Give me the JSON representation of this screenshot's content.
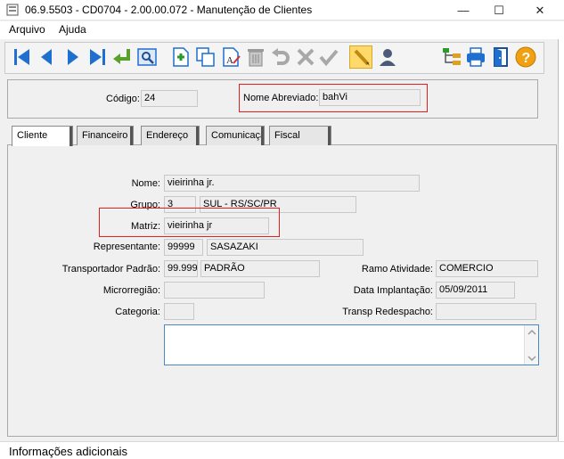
{
  "window": {
    "title": "06.9.5503 - CD0704 - 2.00.00.072 - Manutenção de Clientes",
    "minimize_glyph": "—",
    "maximize_glyph": "☐",
    "close_glyph": "✕"
  },
  "menu": {
    "items": [
      {
        "label": "Arquivo"
      },
      {
        "label": "Ajuda"
      }
    ]
  },
  "toolbar": {
    "buttons": [
      {
        "name": "first-record",
        "icon": "first-icon"
      },
      {
        "name": "previous-record",
        "icon": "previous-icon"
      },
      {
        "name": "next-record",
        "icon": "next-icon"
      },
      {
        "name": "last-record",
        "icon": "last-icon"
      },
      {
        "name": "goto",
        "icon": "goto-arrow-icon"
      },
      {
        "name": "search",
        "icon": "search-icon"
      },
      {
        "name": "new",
        "icon": "new-document-icon"
      },
      {
        "name": "copy",
        "icon": "copy-icon"
      },
      {
        "name": "edit",
        "icon": "edit-document-icon"
      },
      {
        "name": "delete",
        "icon": "trash-icon"
      },
      {
        "name": "undo",
        "icon": "undo-icon"
      },
      {
        "name": "cancel",
        "icon": "cancel-x-icon"
      },
      {
        "name": "confirm",
        "icon": "checkmark-icon"
      },
      {
        "name": "pencil",
        "icon": "pencil-icon"
      },
      {
        "name": "user",
        "icon": "user-icon"
      },
      {
        "name": "tree",
        "icon": "tree-icon"
      },
      {
        "name": "print",
        "icon": "printer-icon"
      },
      {
        "name": "exit",
        "icon": "exit-door-icon"
      },
      {
        "name": "help",
        "icon": "help-icon"
      }
    ]
  },
  "header": {
    "codigo_label": "Código:",
    "codigo_value": "24",
    "nome_abreviado_label": "Nome Abreviado:",
    "nome_abreviado_value": "bahVi"
  },
  "tabs": [
    {
      "label": "Cliente",
      "active": true
    },
    {
      "label": "Financeiro",
      "active": false
    },
    {
      "label": "Endereço",
      "active": false
    },
    {
      "label": "Comunicaçã",
      "active": false
    },
    {
      "label": "Fiscal",
      "active": false
    }
  ],
  "form": {
    "nome_label": "Nome:",
    "nome_value": "vieirinha jr.",
    "grupo_label": "Grupo:",
    "grupo_code": "3",
    "grupo_desc": "SUL - RS/SC/PR",
    "matriz_label": "Matriz:",
    "matriz_value": "vieirinha jr",
    "representante_label": "Representante:",
    "representante_code": "99999",
    "representante_name": "SASAZAKI",
    "transportador_label": "Transportador Padrão:",
    "transportador_code": "99.999",
    "transportador_name": "PADRÃO",
    "ramo_label": "Ramo Atividade:",
    "ramo_value": "COMERCIO",
    "microrregiao_label": "Microrregião:",
    "microrregiao_value": "",
    "data_label": "Data Implantação:",
    "data_value": "05/09/2011",
    "categoria_label": "Categoria:",
    "categoria_value": "",
    "transp_redespacho_label": "Transp Redespacho:",
    "transp_redespacho_value": ""
  },
  "status": {
    "text": "Informações adicionais"
  },
  "colors": {
    "highlight_box": "#e02020",
    "toolbar_icon_blue": "#1e6fd0",
    "active_tool": "#ffd96a"
  }
}
